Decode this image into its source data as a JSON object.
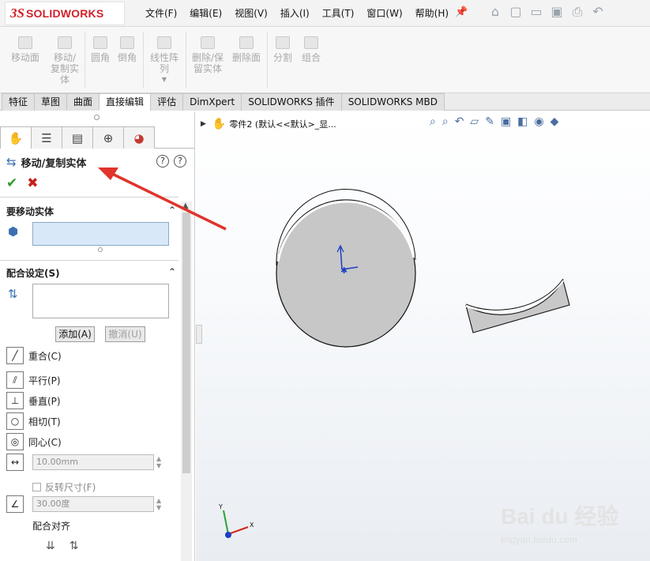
{
  "app": {
    "logo_prefix": "3S",
    "logo_text": "SOLIDWORKS"
  },
  "menu": [
    "文件(F)",
    "编辑(E)",
    "视图(V)",
    "插入(I)",
    "工具(T)",
    "窗口(W)",
    "帮助(H)"
  ],
  "toolbar": {
    "tools": [
      {
        "label": "移动面"
      },
      {
        "label": "移动/\n复制实\n体"
      },
      {
        "label": "圆角"
      },
      {
        "label": "倒角"
      },
      {
        "label": "线性阵\n列"
      },
      {
        "label": "删除/保\n留实体"
      },
      {
        "label": "删除面"
      },
      {
        "label": "分割"
      },
      {
        "label": "组合"
      }
    ]
  },
  "tabs": [
    "特征",
    "草图",
    "曲面",
    "直接编辑",
    "评估",
    "DimXpert",
    "SOLIDWORKS 插件",
    "SOLIDWORKS MBD"
  ],
  "active_tab": "直接编辑",
  "property_manager": {
    "title": "移动/复制实体",
    "section_bodies": "要移动实体",
    "section_mates": "配合设定(S)",
    "add_button": "添加(A)",
    "undo_button": "撤消(U)",
    "mates": [
      "重合(C)",
      "平行(P)",
      "垂直(P)",
      "相切(T)",
      "同心(C)"
    ],
    "distance_value": "10.00mm",
    "flip_dimension": "反转尺寸(F)",
    "angle_value": "30.00度",
    "mate_alignment": "配合对齐"
  },
  "graphics": {
    "tree_label": "零件2 (默认<<默认>_显...",
    "triad": {
      "x": "X",
      "y": "Y"
    }
  },
  "watermark": {
    "title": "Bai du 经验",
    "url": "jingyan.baidu.com"
  },
  "colors": {
    "accent": "#d0212a",
    "arrow": "#e0342b",
    "model_fill": "#c8c8c8"
  }
}
